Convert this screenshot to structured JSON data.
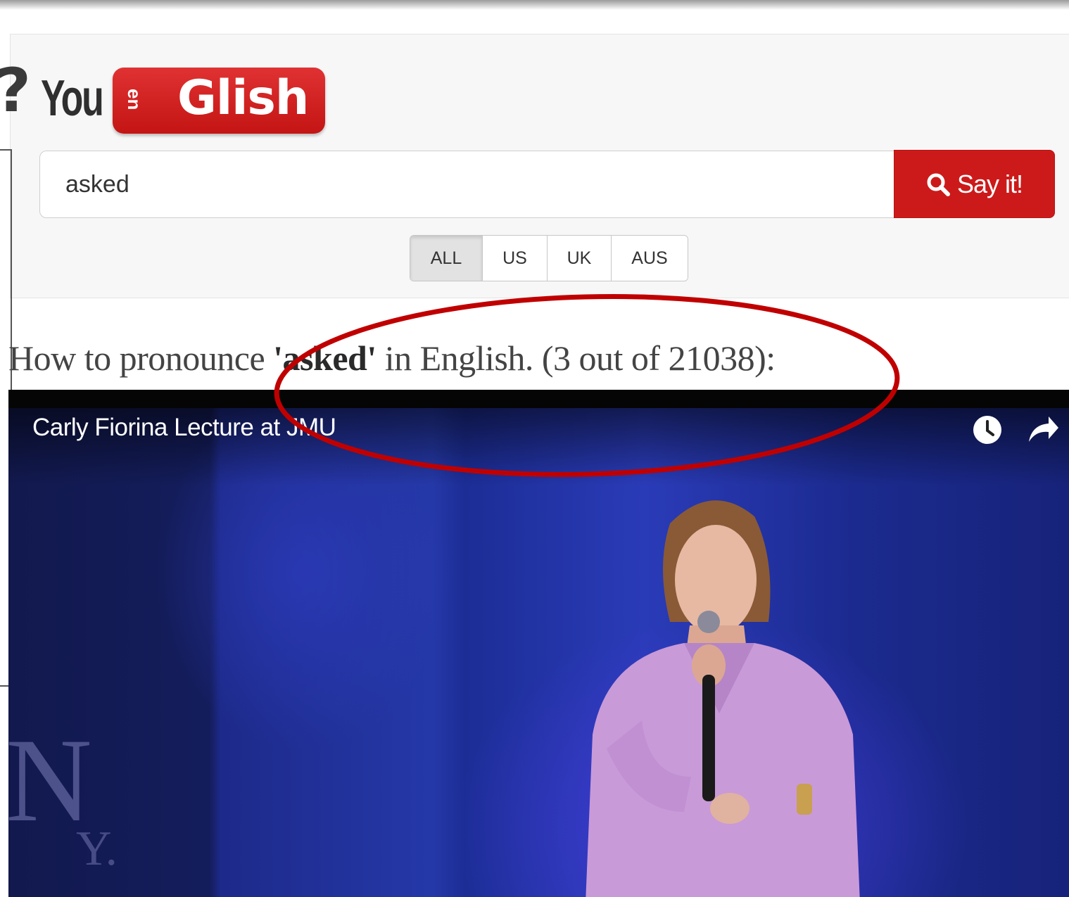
{
  "logo": {
    "question_mark": "?",
    "you": "You",
    "en": "en",
    "glish": "Glish"
  },
  "search": {
    "value": "asked",
    "button_label": "Say it!"
  },
  "accents": {
    "options": [
      "ALL",
      "US",
      "UK",
      "AUS"
    ],
    "selected": "ALL"
  },
  "result": {
    "prefix": "How to pronounce ",
    "word": "'asked'",
    "suffix": " in English. (3 out of 21038):"
  },
  "video": {
    "title": "Carly Fiorina Lecture at JMU",
    "watch_later_icon": "clock-icon",
    "share_icon": "share-arrow-icon",
    "stage_text_1": "N",
    "stage_text_2": "Y."
  },
  "colors": {
    "brand_red": "#cc1a1a",
    "annotation_red": "#c00000"
  }
}
